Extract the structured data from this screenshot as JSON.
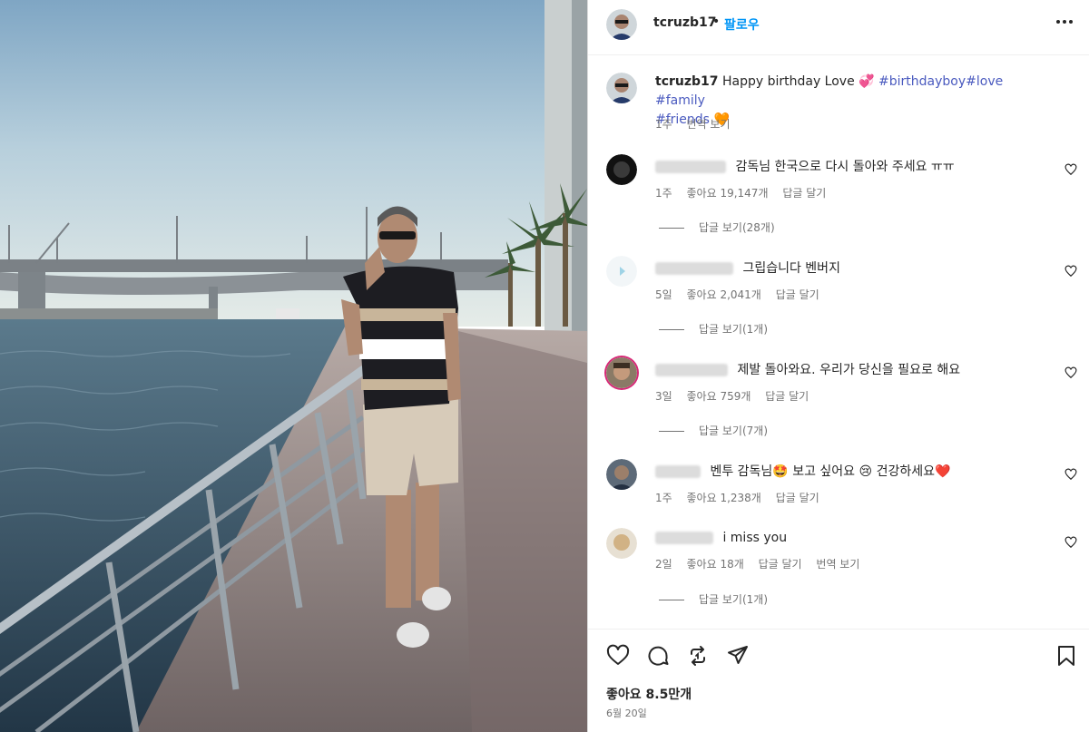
{
  "post": {
    "username": "tcruzb17",
    "dot": "•",
    "follow_label": "팔로우",
    "more_icon": "more-horizontal-icon"
  },
  "caption": {
    "username": "tcruzb17",
    "text": "Happy birthday Love",
    "emoji_1": "💞",
    "hashtags_line1": "#birthdayboy#love #family",
    "hashtags_line2": "#friends",
    "emoji_2": "🧡",
    "time": "1주",
    "translate": "번역 보기"
  },
  "comments": [
    {
      "text": "감독님 한국으로 다시 돌아와 주세요 ㅠㅠ",
      "time": "1주",
      "likes": "좋아요 19,147개",
      "reply": "답글 달기",
      "view_replies": "답글 보기(28개)"
    },
    {
      "text": "그립습니다 벤버지",
      "time": "5일",
      "likes": "좋아요 2,041개",
      "reply": "답글 달기",
      "view_replies": "답글 보기(1개)"
    },
    {
      "text": "제발 돌아와요. 우리가 당신을 필요로 해요",
      "time": "3일",
      "likes": "좋아요 759개",
      "reply": "답글 달기",
      "view_replies": "답글 보기(7개)"
    },
    {
      "text_a": "벤투 감독님",
      "emoji_a": "🤩",
      "text_b": "보고 싶어요",
      "emoji_b": "😢",
      "text_c": "건강하세요",
      "emoji_c": "❤️",
      "time": "1주",
      "likes": "좋아요 1,238개",
      "reply": "답글 달기"
    },
    {
      "text": "i miss you",
      "time": "2일",
      "likes": "좋아요 18개",
      "reply": "답글 달기",
      "translate": "번역 보기",
      "view_replies": "답글 보기(1개)"
    }
  ],
  "actions": {
    "like_icon": "heart-icon",
    "comment_icon": "comment-icon",
    "repost_icon": "repost-icon",
    "share_icon": "share-icon",
    "save_icon": "bookmark-icon",
    "likes_total": "좋아요 8.5만개",
    "date": "6월 20일"
  },
  "colors": {
    "accent": "#0095f6",
    "hashtag": "#4a5abf",
    "muted": "#737373"
  }
}
